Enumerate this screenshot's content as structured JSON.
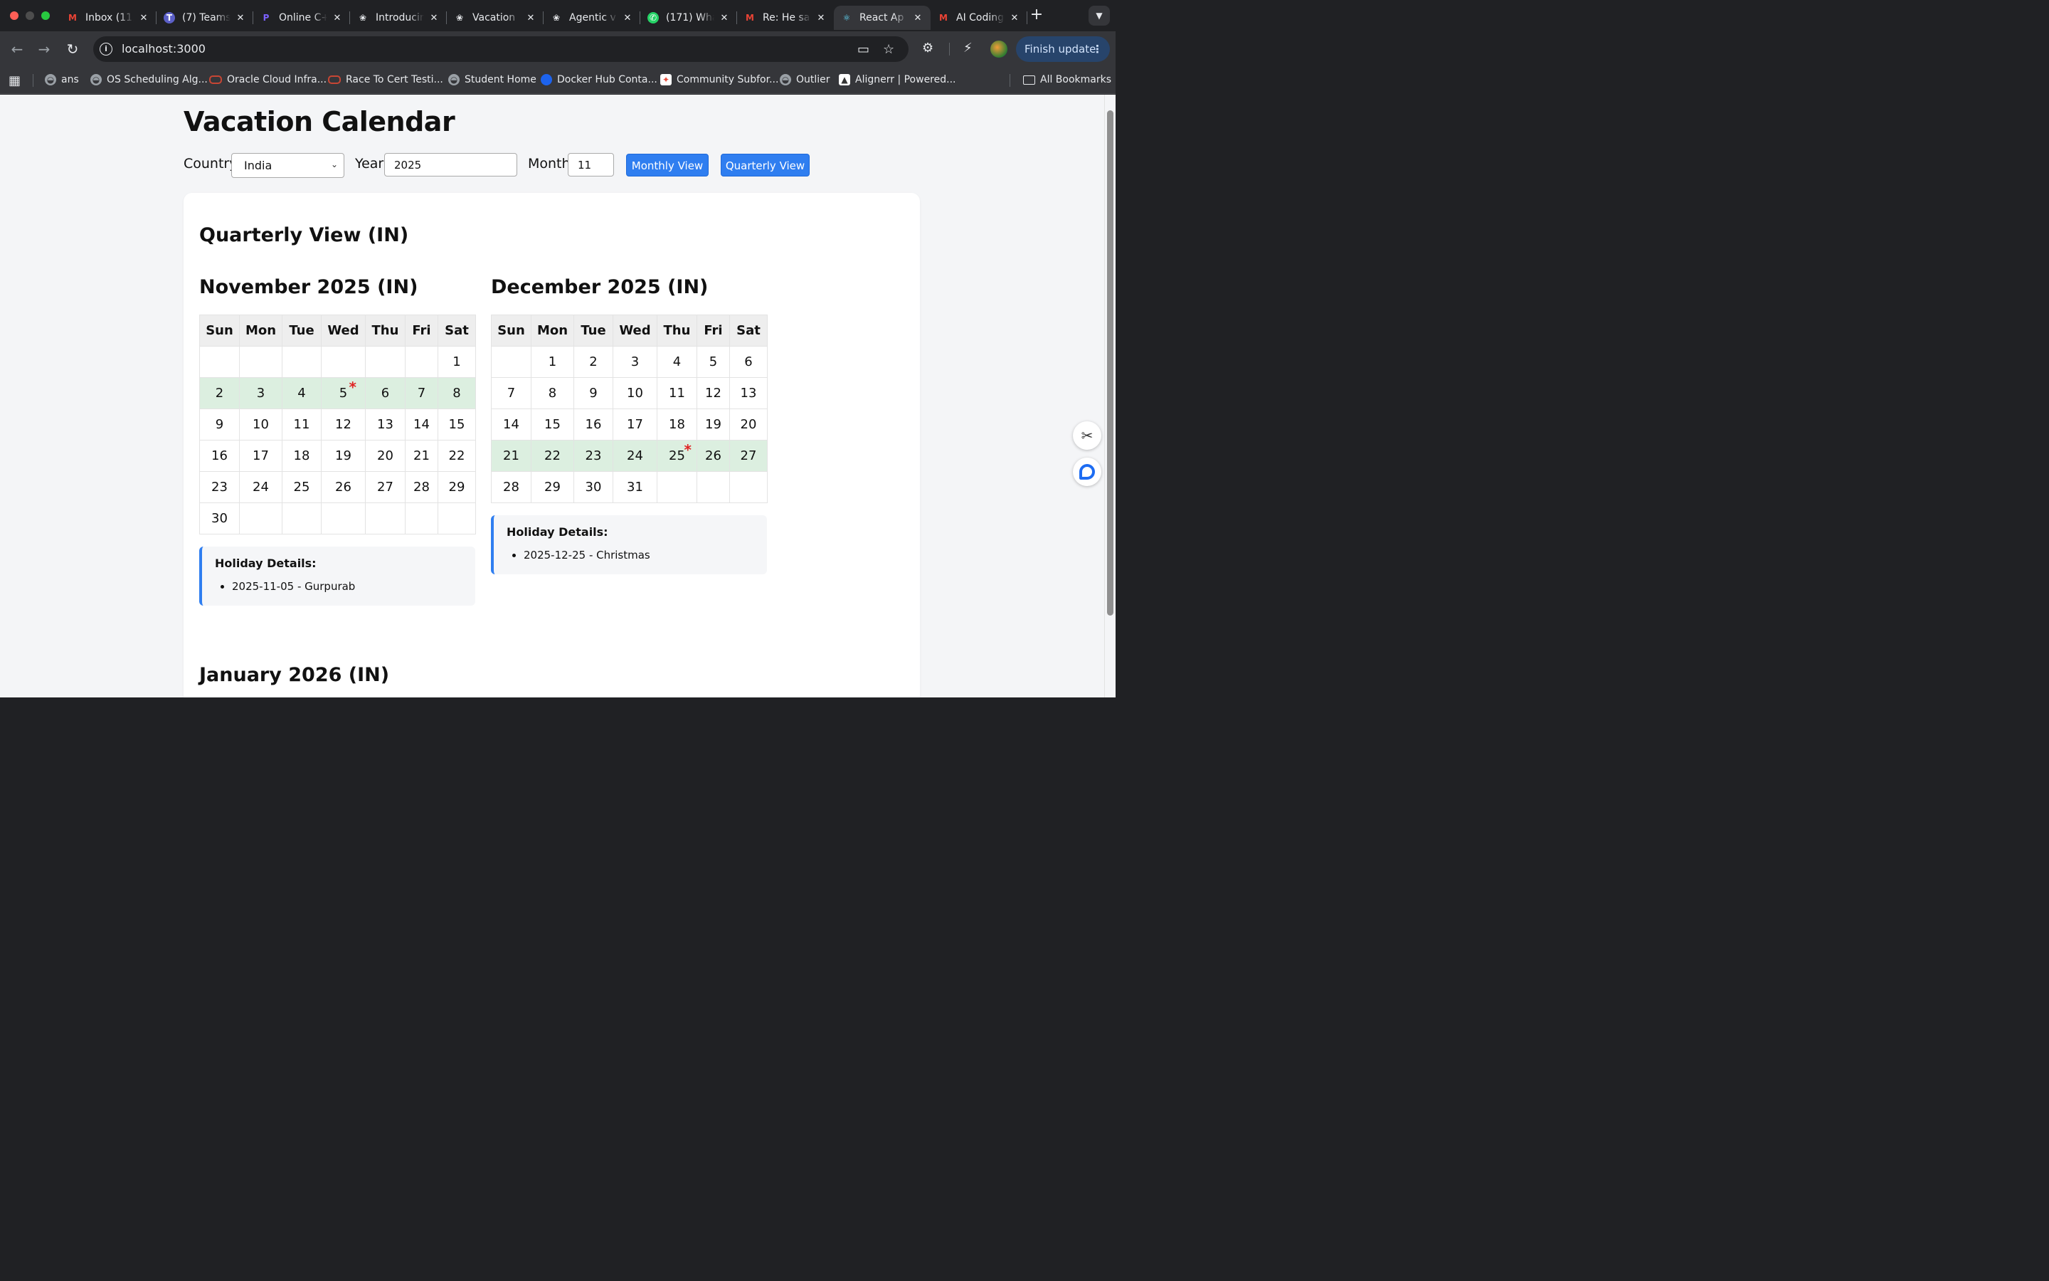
{
  "browser": {
    "tabs": [
      {
        "title": "Inbox (11,",
        "icon": "gmail-icon",
        "active": false
      },
      {
        "title": "(7) Teams",
        "icon": "teams-icon",
        "active": false
      },
      {
        "title": "Online C+",
        "icon": "online-compiler-icon",
        "active": false
      },
      {
        "title": "Introducin",
        "icon": "openai-icon",
        "active": false
      },
      {
        "title": "Vacation",
        "icon": "openai-icon",
        "active": false
      },
      {
        "title": "Agentic v",
        "icon": "openai-icon",
        "active": false
      },
      {
        "title": "(171) Wha",
        "icon": "whatsapp-icon",
        "active": false
      },
      {
        "title": "Re: He sa",
        "icon": "gmail-icon",
        "active": false
      },
      {
        "title": "React Ap",
        "icon": "react-icon",
        "active": true
      },
      {
        "title": "AI Coding",
        "icon": "gmail-icon",
        "active": false
      }
    ],
    "url": "localhost:3000",
    "finish_update": "Finish update",
    "bookmarks": [
      {
        "label": "ans",
        "icon": "globe-icon"
      },
      {
        "label": "OS Scheduling Alg...",
        "icon": "globe-icon"
      },
      {
        "label": "Oracle Cloud Infra...",
        "icon": "oracle-icon"
      },
      {
        "label": "Race To Cert Testi...",
        "icon": "oracle-icon"
      },
      {
        "label": "Student Home",
        "icon": "globe-icon"
      },
      {
        "label": "Docker Hub Conta...",
        "icon": "docker-icon"
      },
      {
        "label": "Community Subfor...",
        "icon": "community-icon"
      },
      {
        "label": "Outlier",
        "icon": "globe-icon"
      },
      {
        "label": "Alignerr | Powered...",
        "icon": "alignerr-icon"
      }
    ],
    "all_bookmarks": "All Bookmarks"
  },
  "app": {
    "title": "Vacation Calendar",
    "controls": {
      "country_label": "Country:",
      "country_value": "India",
      "year_label": "Year:",
      "year_value": "2025",
      "month_label": "Month:",
      "month_value": "11",
      "monthly_button": "Monthly View",
      "quarterly_button": "Quarterly View"
    },
    "view_title": "Quarterly View (IN)",
    "weekdays": [
      "Sun",
      "Mon",
      "Tue",
      "Wed",
      "Thu",
      "Fri",
      "Sat"
    ],
    "months": [
      {
        "title": "November 2025 (IN)",
        "weeks": [
          [
            "",
            "",
            "",
            "",
            "",
            "",
            "1"
          ],
          [
            "2",
            "3",
            "4",
            "5",
            "6",
            "7",
            "8"
          ],
          [
            "9",
            "10",
            "11",
            "12",
            "13",
            "14",
            "15"
          ],
          [
            "16",
            "17",
            "18",
            "19",
            "20",
            "21",
            "22"
          ],
          [
            "23",
            "24",
            "25",
            "26",
            "27",
            "28",
            "29"
          ],
          [
            "30",
            "",
            "",
            "",
            "",
            "",
            ""
          ]
        ],
        "highlighted_week": 1,
        "holiday_days": [
          "5"
        ],
        "details_heading": "Holiday Details:",
        "holidays": [
          "2025-11-05 - Gurpurab"
        ]
      },
      {
        "title": "December 2025 (IN)",
        "weeks": [
          [
            "",
            "1",
            "2",
            "3",
            "4",
            "5",
            "6"
          ],
          [
            "7",
            "8",
            "9",
            "10",
            "11",
            "12",
            "13"
          ],
          [
            "14",
            "15",
            "16",
            "17",
            "18",
            "19",
            "20"
          ],
          [
            "21",
            "22",
            "23",
            "24",
            "25",
            "26",
            "27"
          ],
          [
            "28",
            "29",
            "30",
            "31",
            "",
            "",
            ""
          ]
        ],
        "highlighted_week": 3,
        "holiday_days": [
          "25"
        ],
        "details_heading": "Holiday Details:",
        "holidays": [
          "2025-12-25 - Christmas"
        ]
      }
    ],
    "next_month_title": "January 2026 (IN)",
    "holiday_marker": "*"
  },
  "colors": {
    "accent": "#2f7ef0",
    "week_highlight": "#dcefe0",
    "holiday_star": "#e02424"
  }
}
